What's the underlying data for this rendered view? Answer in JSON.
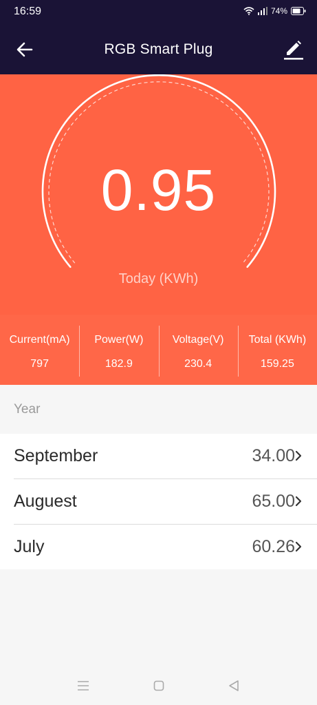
{
  "status": {
    "time": "16:59",
    "battery": "74%"
  },
  "appbar": {
    "title": "RGB Smart Plug",
    "back_icon": "back-arrow-icon",
    "edit_icon": "pencil-icon"
  },
  "gauge": {
    "value": "0.95",
    "label": "Today (KWh)"
  },
  "stats": [
    {
      "label": "Current(mA)",
      "value": "797"
    },
    {
      "label": "Power(W)",
      "value": "182.9"
    },
    {
      "label": "Voltage(V)",
      "value": "230.4"
    },
    {
      "label": "Total (KWh)",
      "value": "159.25"
    }
  ],
  "history": {
    "header": "Year",
    "rows": [
      {
        "label": "September",
        "value": "34.00"
      },
      {
        "label": "Auguest",
        "value": "65.00"
      },
      {
        "label": "July",
        "value": "60.26"
      }
    ]
  },
  "colors": {
    "appbar": "#1a1336",
    "hero": "#ff6344",
    "stats": "#ff6748"
  }
}
